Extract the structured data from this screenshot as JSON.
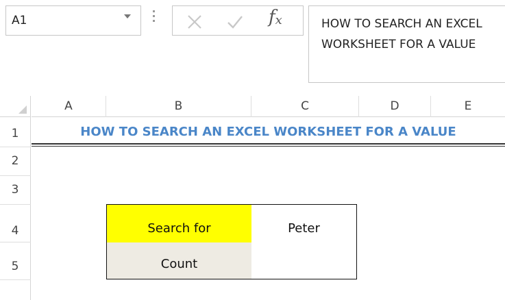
{
  "name_box": {
    "value": "A1"
  },
  "formula_bar": {
    "fx_label": "fx",
    "content": "HOW TO SEARCH AN EXCEL WORKSHEET FOR A VALUE"
  },
  "columns": [
    "A",
    "B",
    "C",
    "D",
    "E"
  ],
  "rows": [
    "1",
    "2",
    "3",
    "4",
    "5"
  ],
  "sheet": {
    "title": "HOW TO SEARCH AN EXCEL WORKSHEET FOR A VALUE",
    "search_label": "Search for",
    "search_value": "Peter",
    "count_label": "Count",
    "count_value": ""
  },
  "colors": {
    "title": "#4a86c8",
    "search_fill": "#ffff00",
    "count_fill": "#eeebe3"
  }
}
